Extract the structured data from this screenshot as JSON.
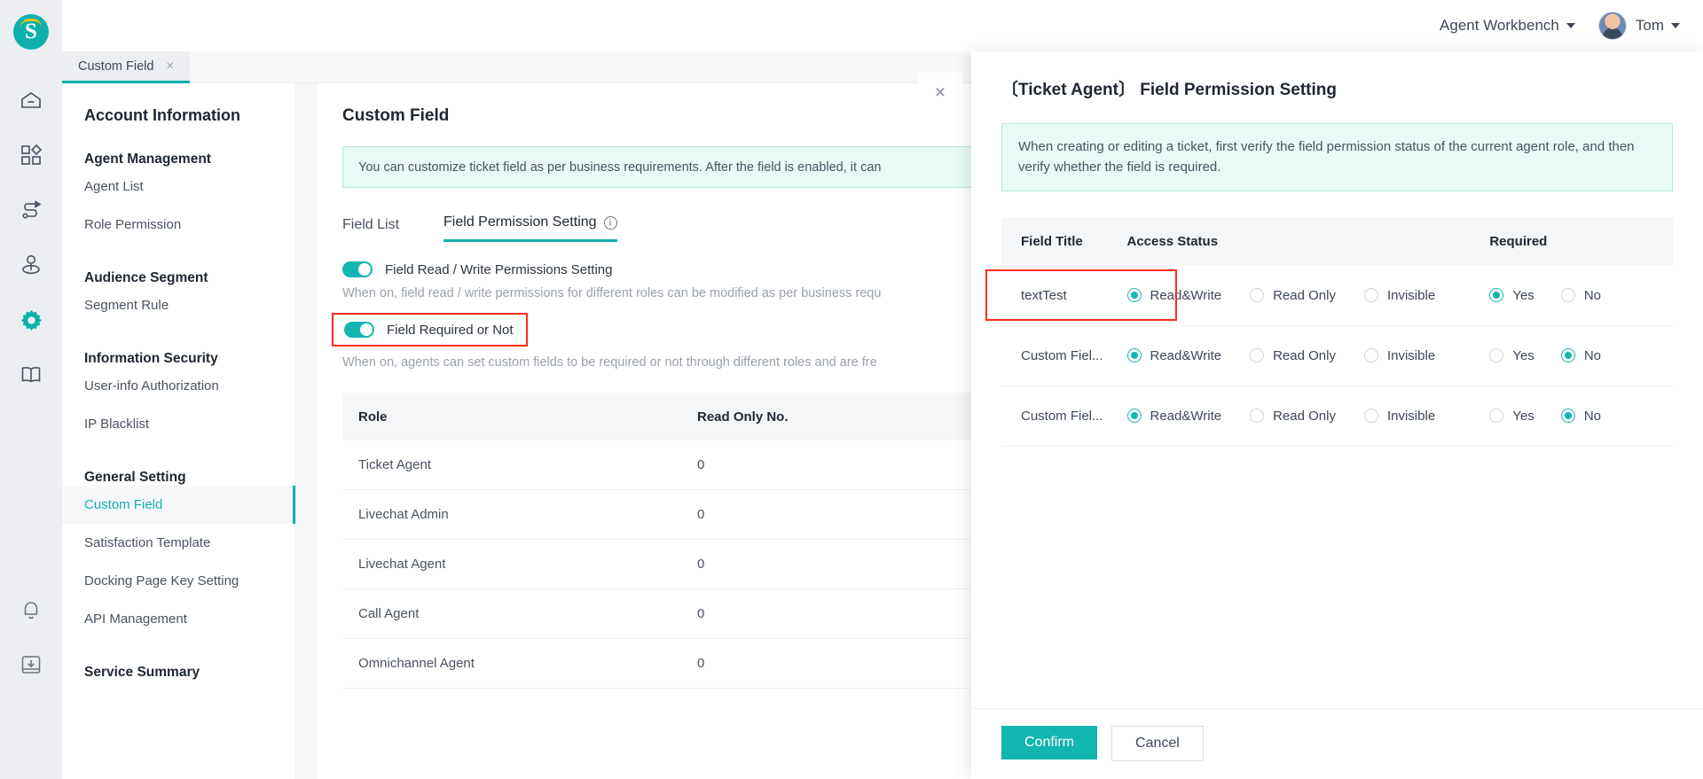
{
  "topbar": {
    "workbench": "Agent Workbench",
    "user_name": "Tom"
  },
  "tabstrip": {
    "tabs": [
      {
        "label": "Custom Field",
        "close": "×"
      }
    ]
  },
  "rail": {
    "logo_letter": "S",
    "icons": [
      "home-icon",
      "apps-icon",
      "workflow-icon",
      "contact-icon",
      "gear-icon",
      "book-icon",
      "bell-icon",
      "inbox-download-icon"
    ]
  },
  "sidebar": {
    "title": "Account Information",
    "groups": [
      {
        "label": "Agent Management",
        "items": [
          {
            "label": "Agent List",
            "active": false
          },
          {
            "label": "Role Permission",
            "active": false
          }
        ]
      },
      {
        "label": "Audience Segment",
        "items": [
          {
            "label": "Segment Rule",
            "active": false
          }
        ]
      },
      {
        "label": "Information Security",
        "items": [
          {
            "label": "User-info Authorization",
            "active": false
          },
          {
            "label": "IP Blacklist",
            "active": false
          }
        ]
      },
      {
        "label": "General Setting",
        "items": [
          {
            "label": "Custom Field",
            "active": true
          },
          {
            "label": "Satisfaction Template",
            "active": false
          },
          {
            "label": "Docking Page Key Setting",
            "active": false
          },
          {
            "label": "API Management",
            "active": false
          }
        ]
      },
      {
        "label": "Service Summary",
        "items": []
      }
    ]
  },
  "main": {
    "page_title": "Custom Field",
    "notice": "You can customize ticket field as per business requirements. After the field is enabled, it can",
    "tabs": [
      {
        "label": "Field List",
        "active": false,
        "has_info": false
      },
      {
        "label": "Field Permission Setting",
        "active": true,
        "has_info": true
      }
    ],
    "settings": [
      {
        "label": "Field Read / Write Permissions Setting",
        "on": true,
        "highlighted": false,
        "desc": "When on, field read / write permissions for different roles can be modified as per business requ"
      },
      {
        "label": "Field Required or Not",
        "on": true,
        "highlighted": true,
        "desc": "When on, agents can set custom fields to be required or not through different roles and are fre"
      }
    ],
    "table": {
      "columns": [
        "Role",
        "Read Only No."
      ],
      "rows": [
        {
          "role": "Ticket Agent",
          "read_only_no": "0"
        },
        {
          "role": "Livechat Admin",
          "read_only_no": "0"
        },
        {
          "role": "Livechat Agent",
          "read_only_no": "0"
        },
        {
          "role": "Call Agent",
          "read_only_no": "0"
        },
        {
          "role": "Omnichannel Agent",
          "read_only_no": "0"
        }
      ]
    }
  },
  "drawer": {
    "close_glyph": "×",
    "title": "〔Ticket Agent〕 Field Permission Setting",
    "notice": "When creating or editing a ticket, first verify the field permission status of the current agent role, and then verify whether the field is required.",
    "columns": [
      "Field Title",
      "Access Status",
      "Required"
    ],
    "access_options": [
      "Read&Write",
      "Read Only",
      "Invisible"
    ],
    "required_options": [
      "Yes",
      "No"
    ],
    "rows": [
      {
        "field_title": "textTest",
        "access": "Read&Write",
        "required": "Yes",
        "required_highlighted": true
      },
      {
        "field_title": "Custom Fiel...",
        "access": "Read&Write",
        "required": "No",
        "required_highlighted": false
      },
      {
        "field_title": "Custom Fiel...",
        "access": "Read&Write",
        "required": "No",
        "required_highlighted": false
      }
    ],
    "confirm_label": "Confirm",
    "cancel_label": "Cancel"
  },
  "colors": {
    "accent": "#13b5b1",
    "highlight": "#ff2d1a",
    "notice_bg": "#e8faf5"
  }
}
